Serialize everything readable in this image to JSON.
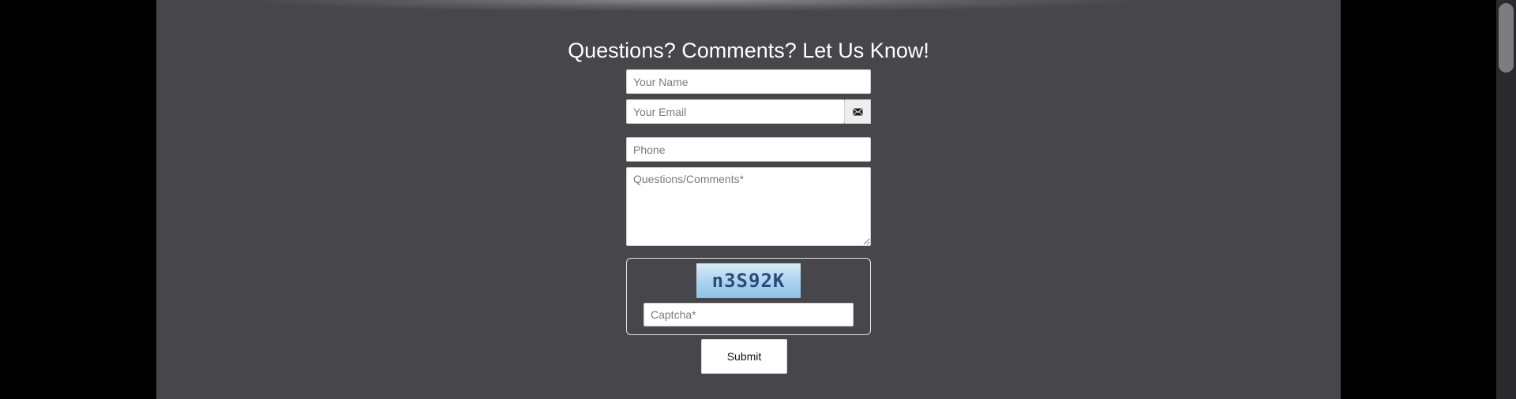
{
  "form": {
    "title": "Questions? Comments? Let Us Know!",
    "name_placeholder": "Your Name",
    "email_placeholder": "Your Email",
    "email_icon": "envelope-icon",
    "phone_placeholder": "Phone",
    "comments_placeholder": "Questions/Comments*",
    "captcha_text": "n3S92K",
    "captcha_placeholder": "Captcha*",
    "submit_label": "Submit"
  },
  "colors": {
    "page_background": "#000000",
    "panel_background": "#47464b",
    "title_text": "#ffffff",
    "captcha_text": "#2c4a7a",
    "captcha_background": "#a9d2ef"
  }
}
